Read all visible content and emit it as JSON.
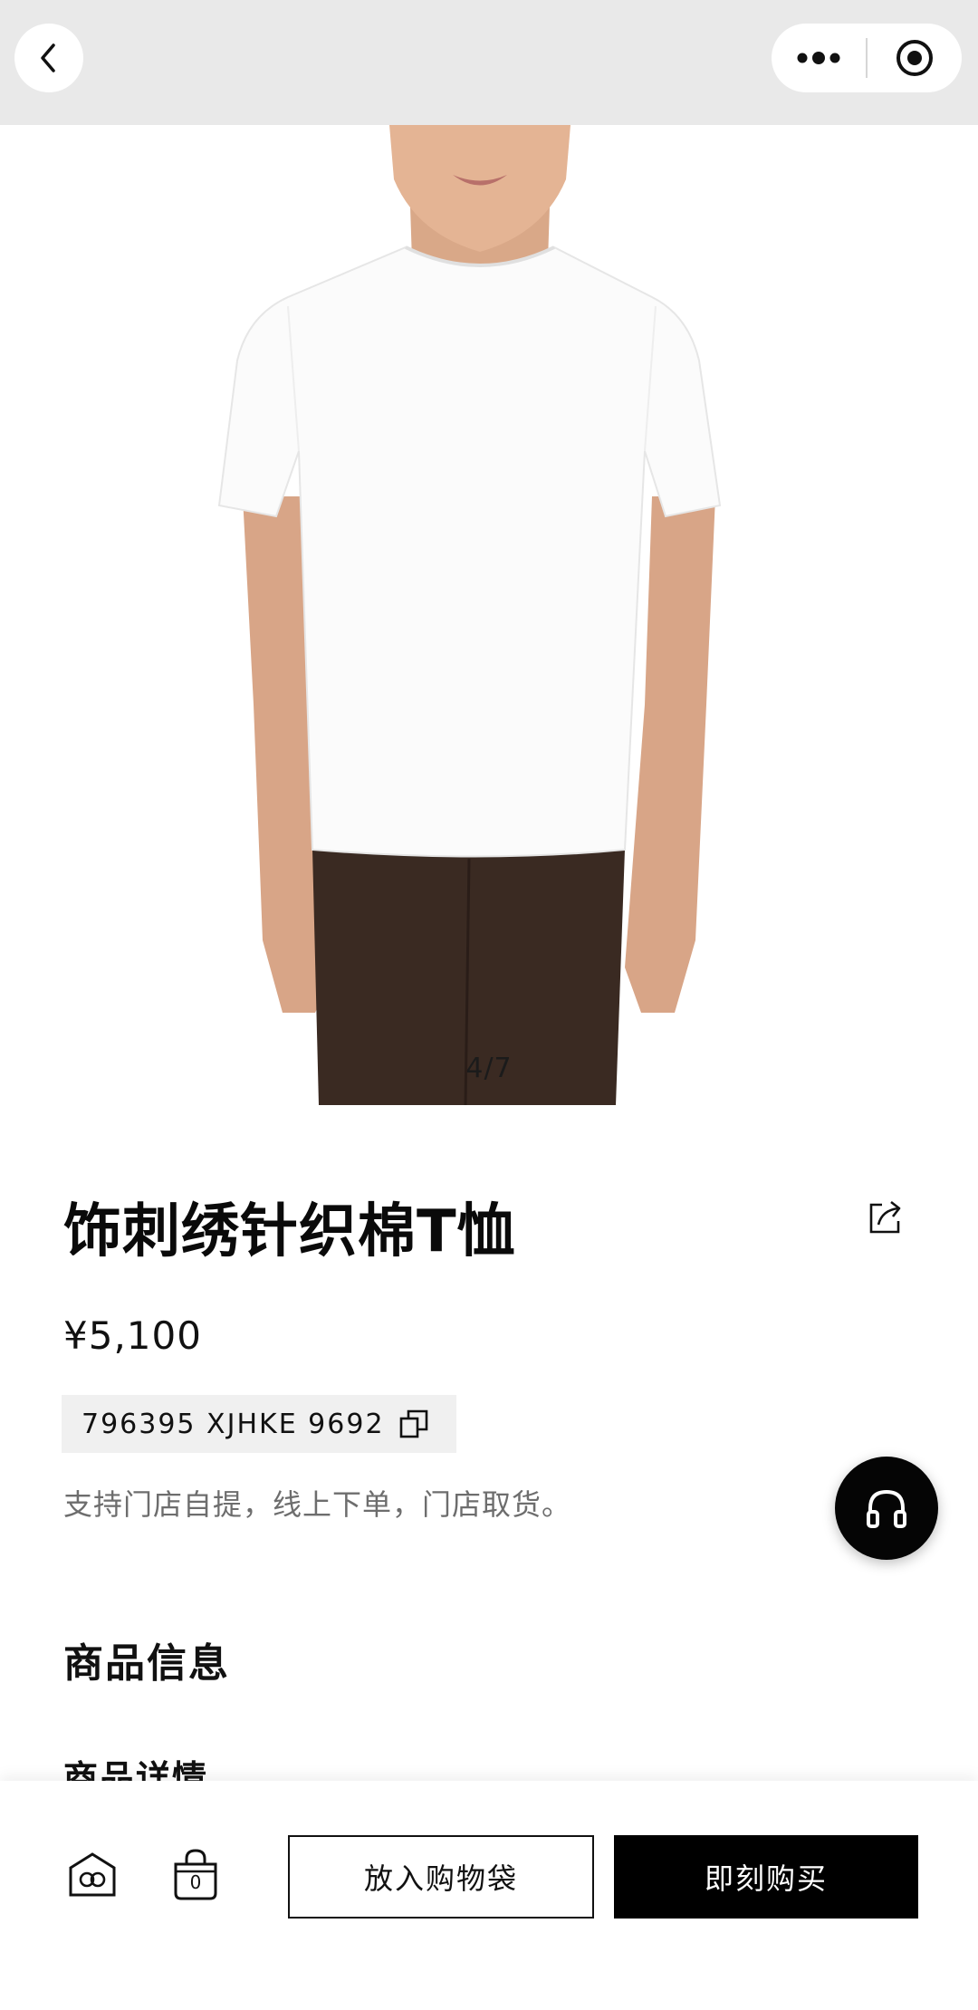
{
  "header": {
    "back_icon": "chevron-left-icon",
    "more_icon": "more-dots-icon",
    "close_icon": "target-circle-icon"
  },
  "gallery": {
    "indicator": "4/7"
  },
  "product": {
    "title": "饰刺绣针织棉T恤",
    "price": "¥5,100",
    "sku": "796395 XJHKE 9692",
    "pickup_note": "支持门店自提，线上下单，门店取货。",
    "share_icon": "share-icon",
    "copy_icon": "copy-icon"
  },
  "customer_service": {
    "icon": "headphones-icon"
  },
  "info": {
    "section_title": "商品信息",
    "details_title": "商品详情"
  },
  "bottom_bar": {
    "store_icon": "store-icon",
    "bag_icon": "shopping-bag-icon",
    "bag_count": "0",
    "add_to_bag_label": "放入购物袋",
    "buy_now_label": "即刻购买"
  }
}
